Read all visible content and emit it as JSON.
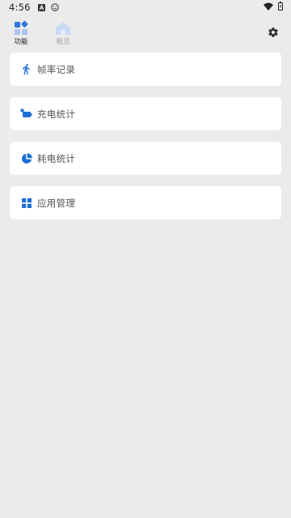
{
  "status_bar": {
    "time": "4:56",
    "icons": [
      "a-badge-icon",
      "smiley-icon",
      "wifi-icon",
      "battery-charging-icon"
    ]
  },
  "nav": {
    "tabs": [
      {
        "label": "功能",
        "icon": "widgets-icon",
        "active": true
      },
      {
        "label": "概览",
        "icon": "home-icon",
        "active": false
      }
    ],
    "settings_icon": "gear-icon"
  },
  "menu": {
    "items": [
      {
        "label": "帧率记录",
        "icon": "running-icon"
      },
      {
        "label": "充电统计",
        "icon": "battery-charge-icon"
      },
      {
        "label": "耗电统计",
        "icon": "pie-chart-icon"
      },
      {
        "label": "应用管理",
        "icon": "grid-apps-icon"
      }
    ]
  },
  "colors": {
    "accent": "#1e6fd8",
    "accent_light": "#b8cdf0",
    "background": "#ebebeb",
    "card": "#ffffff"
  }
}
